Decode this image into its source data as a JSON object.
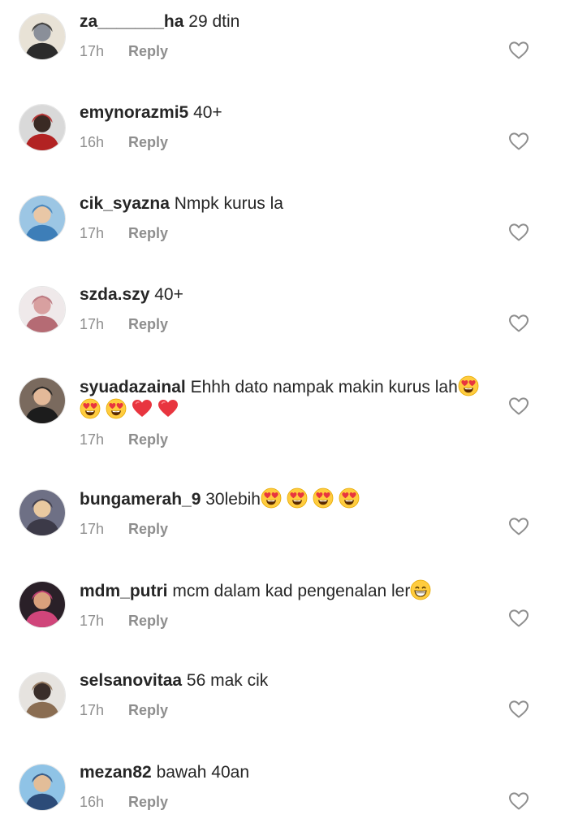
{
  "comments": [
    {
      "username": "za_______ha",
      "text": "29 dtin",
      "time": "17h",
      "reply_label": "Reply",
      "emojis": [],
      "avatar_colors": [
        "#e8e2d6",
        "#8a8f99",
        "#2b2b2b"
      ]
    },
    {
      "username": "emynorazmi5",
      "text": "40+",
      "time": "16h",
      "reply_label": "Reply",
      "emojis": [],
      "avatar_colors": [
        "#d9d9d9",
        "#3a2a24",
        "#b22222"
      ]
    },
    {
      "username": "cik_syazna",
      "text": "Nmpk kurus la",
      "time": "17h",
      "reply_label": "Reply",
      "emojis": [],
      "avatar_colors": [
        "#9cc6e4",
        "#e9c7a6",
        "#3d7eb8"
      ]
    },
    {
      "username": "szda.szy",
      "text": "40+",
      "time": "17h",
      "reply_label": "Reply",
      "emojis": [],
      "avatar_colors": [
        "#efe9ea",
        "#d8a0a0",
        "#b56b74"
      ]
    },
    {
      "username": "syuadazainal",
      "text": "Ehhh dato nampak makin kurus lah",
      "time": "17h",
      "reply_label": "Reply",
      "emojis": [
        "heart-eyes",
        "heart-eyes",
        "heart-eyes",
        "red-heart",
        "red-heart"
      ],
      "avatar_colors": [
        "#7a6a5e",
        "#e3b999",
        "#1c1c1c"
      ]
    },
    {
      "username": "bungamerah_9",
      "text": "30lebih",
      "time": "17h",
      "reply_label": "Reply",
      "emojis": [
        "heart-eyes",
        "heart-eyes",
        "heart-eyes",
        "heart-eyes"
      ],
      "avatar_colors": [
        "#6e7085",
        "#e9c9a0",
        "#3c3a48"
      ]
    },
    {
      "username": "mdm_putri",
      "text": "mcm dalam kad pengenalan ler",
      "time": "17h",
      "reply_label": "Reply",
      "emojis": [
        "grinning"
      ],
      "avatar_colors": [
        "#2a2028",
        "#d9a07c",
        "#d0457a"
      ]
    },
    {
      "username": "selsanovitaa",
      "text": "56 mak cik",
      "time": "17h",
      "reply_label": "Reply",
      "emojis": [],
      "avatar_colors": [
        "#e6e3df",
        "#3a2e2a",
        "#8a6d52"
      ]
    },
    {
      "username": "mezan82",
      "text": "bawah 40an",
      "time": "16h",
      "reply_label": "Reply",
      "emojis": [],
      "avatar_colors": [
        "#8fc3e6",
        "#e3bd98",
        "#2c4b78"
      ]
    }
  ],
  "icons": {
    "like": "heart-outline-icon",
    "heart_eyes": "heart-eyes-emoji",
    "red_heart": "red-heart-emoji",
    "grinning": "grinning-emoji"
  },
  "colors": {
    "text": "#262626",
    "meta": "#8e8e8e",
    "heart_outline": "#8e8e8e",
    "emoji_yellow": "#ffcc3e",
    "emoji_red": "#e8353f"
  }
}
